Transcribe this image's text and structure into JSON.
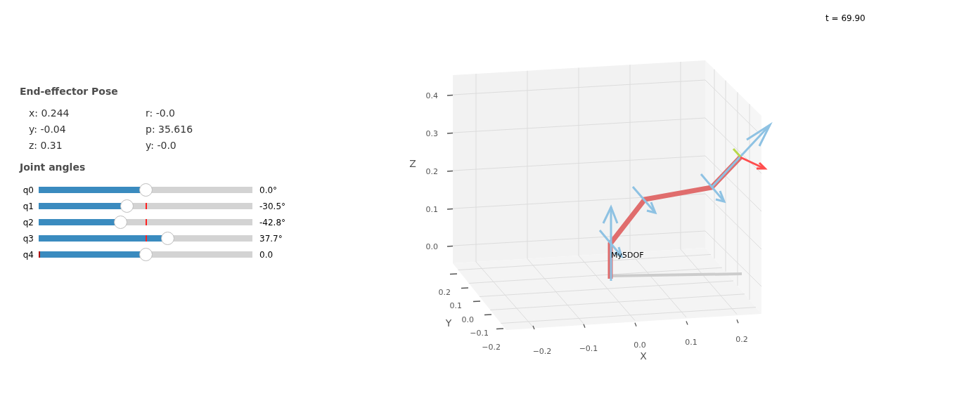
{
  "time_label": "t = 69.90",
  "pose": {
    "title": "End-effector Pose",
    "values": [
      {
        "text": "x: 0.244"
      },
      {
        "text": "r: -0.0"
      },
      {
        "text": "y: -0.04"
      },
      {
        "text": "p: 35.616"
      },
      {
        "text": "z: 0.31"
      },
      {
        "text": "y: -0.0"
      }
    ]
  },
  "joints": {
    "title": "Joint angles",
    "items": [
      {
        "label": "q0",
        "level": 0.5,
        "reference_at_start": false,
        "reading": "0.0°"
      },
      {
        "label": "q1",
        "level": 0.414,
        "reference_at_start": false,
        "reading": "-30.5°"
      },
      {
        "label": "q2",
        "level": 0.382,
        "reference_at_start": false,
        "reading": "-42.8°"
      },
      {
        "label": "q3",
        "level": 0.605,
        "reference_at_start": false,
        "reading": "37.7°"
      },
      {
        "label": "q4",
        "level": 0.5,
        "reference_at_start": true,
        "reading": "0.0"
      }
    ]
  },
  "plot": {
    "z_label": "Z",
    "y_label": "Y",
    "x_label": "X",
    "z_ticks": [
      "0.4",
      "0.3",
      "0.2",
      "0.1",
      "0.0"
    ],
    "y_ticks": [
      "0.2",
      "0.1",
      "0.0",
      "−0.1",
      "−0.2"
    ],
    "x_ticks": [
      "−0.2",
      "−0.1",
      "0.0",
      "0.1",
      "0.2"
    ],
    "robot_label": "My5DOF"
  }
}
